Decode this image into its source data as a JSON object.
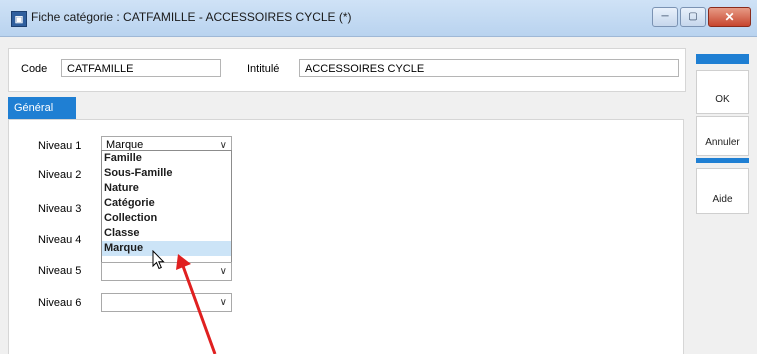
{
  "window": {
    "title": "Fiche catégorie : CATFAMILLE - ACCESSOIRES CYCLE (*)",
    "app_icon_glyph": "▣",
    "minimize_glyph": "─",
    "maximize_glyph": "▢",
    "close_glyph": "✕"
  },
  "header": {
    "code_label": "Code",
    "code_value": "CATFAMILLE",
    "intitule_label": "Intitulé",
    "intitule_value": "ACCESSOIRES CYCLE"
  },
  "tabs": [
    {
      "label": "Général"
    }
  ],
  "levels": [
    {
      "label": "Niveau 1",
      "value": "Marque"
    },
    {
      "label": "Niveau 2",
      "value": ""
    },
    {
      "label": "Niveau 3",
      "value": ""
    },
    {
      "label": "Niveau 4",
      "value": ""
    },
    {
      "label": "Niveau 5",
      "value": ""
    },
    {
      "label": "Niveau 6",
      "value": ""
    }
  ],
  "dropdown": {
    "options": [
      "Famille",
      "Sous-Famille",
      "Nature",
      "Catégorie",
      "Collection",
      "Classe",
      "Marque"
    ],
    "highlighted": "Marque"
  },
  "chevron_glyph": "∨",
  "sidebar": {
    "ok_label": "OK",
    "cancel_label": "Annuler",
    "help_label": "Aide"
  },
  "colors": {
    "accent": "#1f7fd3",
    "annotation_arrow": "#e02020",
    "highlight": "#cce4f7"
  }
}
